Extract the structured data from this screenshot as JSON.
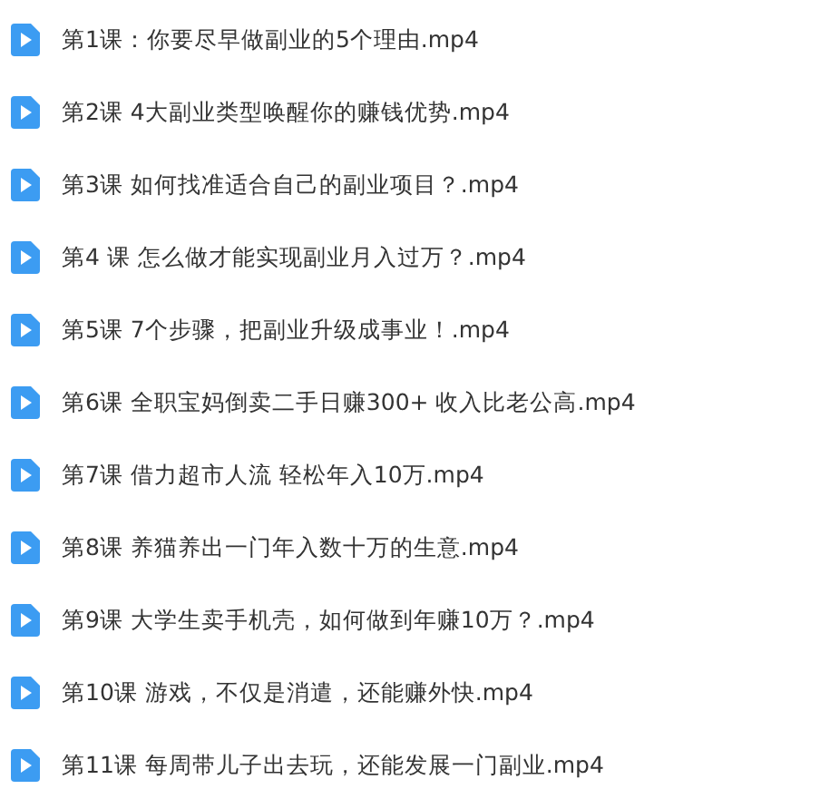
{
  "files": [
    {
      "name": "第1课：你要尽早做副业的5个理由.mp4"
    },
    {
      "name": "第2课 4大副业类型唤醒你的赚钱优势.mp4"
    },
    {
      "name": "第3课 如何找准适合自己的副业项目？.mp4"
    },
    {
      "name": "第4 课 怎么做才能实现副业月入过万？.mp4"
    },
    {
      "name": "第5课 7个步骤，把副业升级成事业！.mp4"
    },
    {
      "name": "第6课 全职宝妈倒卖二手日赚300+ 收入比老公高.mp4"
    },
    {
      "name": "第7课 借力超市人流 轻松年入10万.mp4"
    },
    {
      "name": "第8课 养猫养出一门年入数十万的生意.mp4"
    },
    {
      "name": "第9课 大学生卖手机壳，如何做到年赚10万？.mp4"
    },
    {
      "name": "第10课 游戏，不仅是消遣，还能赚外快.mp4"
    },
    {
      "name": "第11课 每周带儿子出去玩，还能发展一门副业.mp4"
    }
  ]
}
